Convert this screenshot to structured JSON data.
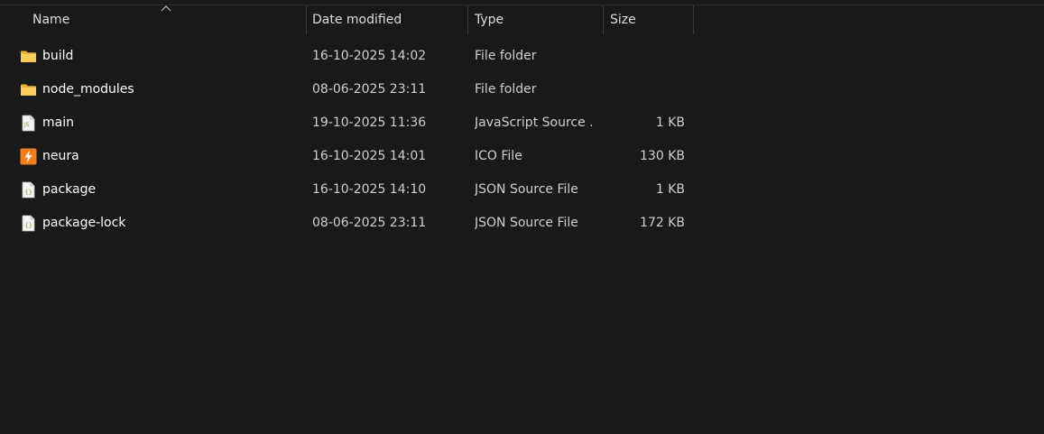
{
  "columns": {
    "name": "Name",
    "date": "Date modified",
    "type": "Type",
    "size": "Size"
  },
  "sort": {
    "column": "name",
    "direction": "ascending"
  },
  "files": [
    {
      "name": "build",
      "date": "16-10-2025 14:02",
      "type": "File folder",
      "size": "",
      "icon": "folder-icon"
    },
    {
      "name": "node_modules",
      "date": "08-06-2025 23:11",
      "type": "File folder",
      "size": "",
      "icon": "folder-icon"
    },
    {
      "name": "main",
      "date": "19-10-2025 11:36",
      "type": "JavaScript Source ...",
      "size": "1 KB",
      "icon": "js-file-icon"
    },
    {
      "name": "neura",
      "date": "16-10-2025 14:01",
      "type": "ICO File",
      "size": "130 KB",
      "icon": "ico-file-icon"
    },
    {
      "name": "package",
      "date": "16-10-2025 14:10",
      "type": "JSON Source File",
      "size": "1 KB",
      "icon": "json-file-icon"
    },
    {
      "name": "package-lock",
      "date": "08-06-2025 23:11",
      "type": "JSON Source File",
      "size": "172 KB",
      "icon": "json-file-icon"
    }
  ],
  "colors": {
    "background": "#191919",
    "folder": "#f2c14e",
    "ico_accent": "#f07e1b"
  }
}
